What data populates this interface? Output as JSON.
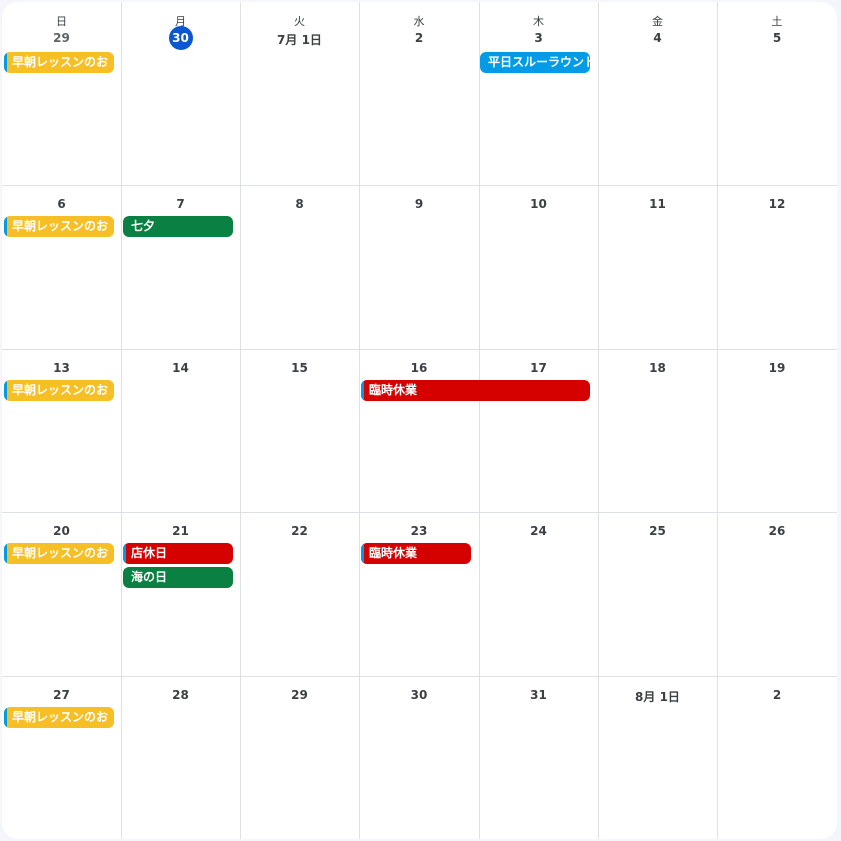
{
  "colors": {
    "yellow": "#f6bf26",
    "blue": "#039be5",
    "green": "#0b8043",
    "red": "#d50000",
    "today": "#0b57d0"
  },
  "weekdays": [
    "日",
    "月",
    "火",
    "水",
    "木",
    "金",
    "土"
  ],
  "weeks": [
    {
      "days": [
        "29",
        "30",
        "7月 1日",
        "2",
        "3",
        "4",
        "5"
      ]
    },
    {
      "days": [
        "6",
        "7",
        "8",
        "9",
        "10",
        "11",
        "12"
      ]
    },
    {
      "days": [
        "13",
        "14",
        "15",
        "16",
        "17",
        "18",
        "19"
      ]
    },
    {
      "days": [
        "20",
        "21",
        "22",
        "23",
        "24",
        "25",
        "26"
      ]
    },
    {
      "days": [
        "27",
        "28",
        "29",
        "30",
        "31",
        "8月 1日",
        "2"
      ]
    }
  ],
  "today_label": "30",
  "events": [
    {
      "title": "早朝レッスンのお",
      "color": "yellow"
    },
    {
      "title": "平日スルーラウンド",
      "color": "blue"
    },
    {
      "title": "早朝レッスンのお",
      "color": "yellow"
    },
    {
      "title": "七夕",
      "color": "green"
    },
    {
      "title": "早朝レッスンのお",
      "color": "yellow"
    },
    {
      "title": "臨時休業",
      "color": "red"
    },
    {
      "title": "早朝レッスンのお",
      "color": "yellow"
    },
    {
      "title": "店休日",
      "color": "red"
    },
    {
      "title": "海の日",
      "color": "green"
    },
    {
      "title": "臨時休業",
      "color": "red"
    },
    {
      "title": "早朝レッスンのお",
      "color": "yellow"
    }
  ]
}
